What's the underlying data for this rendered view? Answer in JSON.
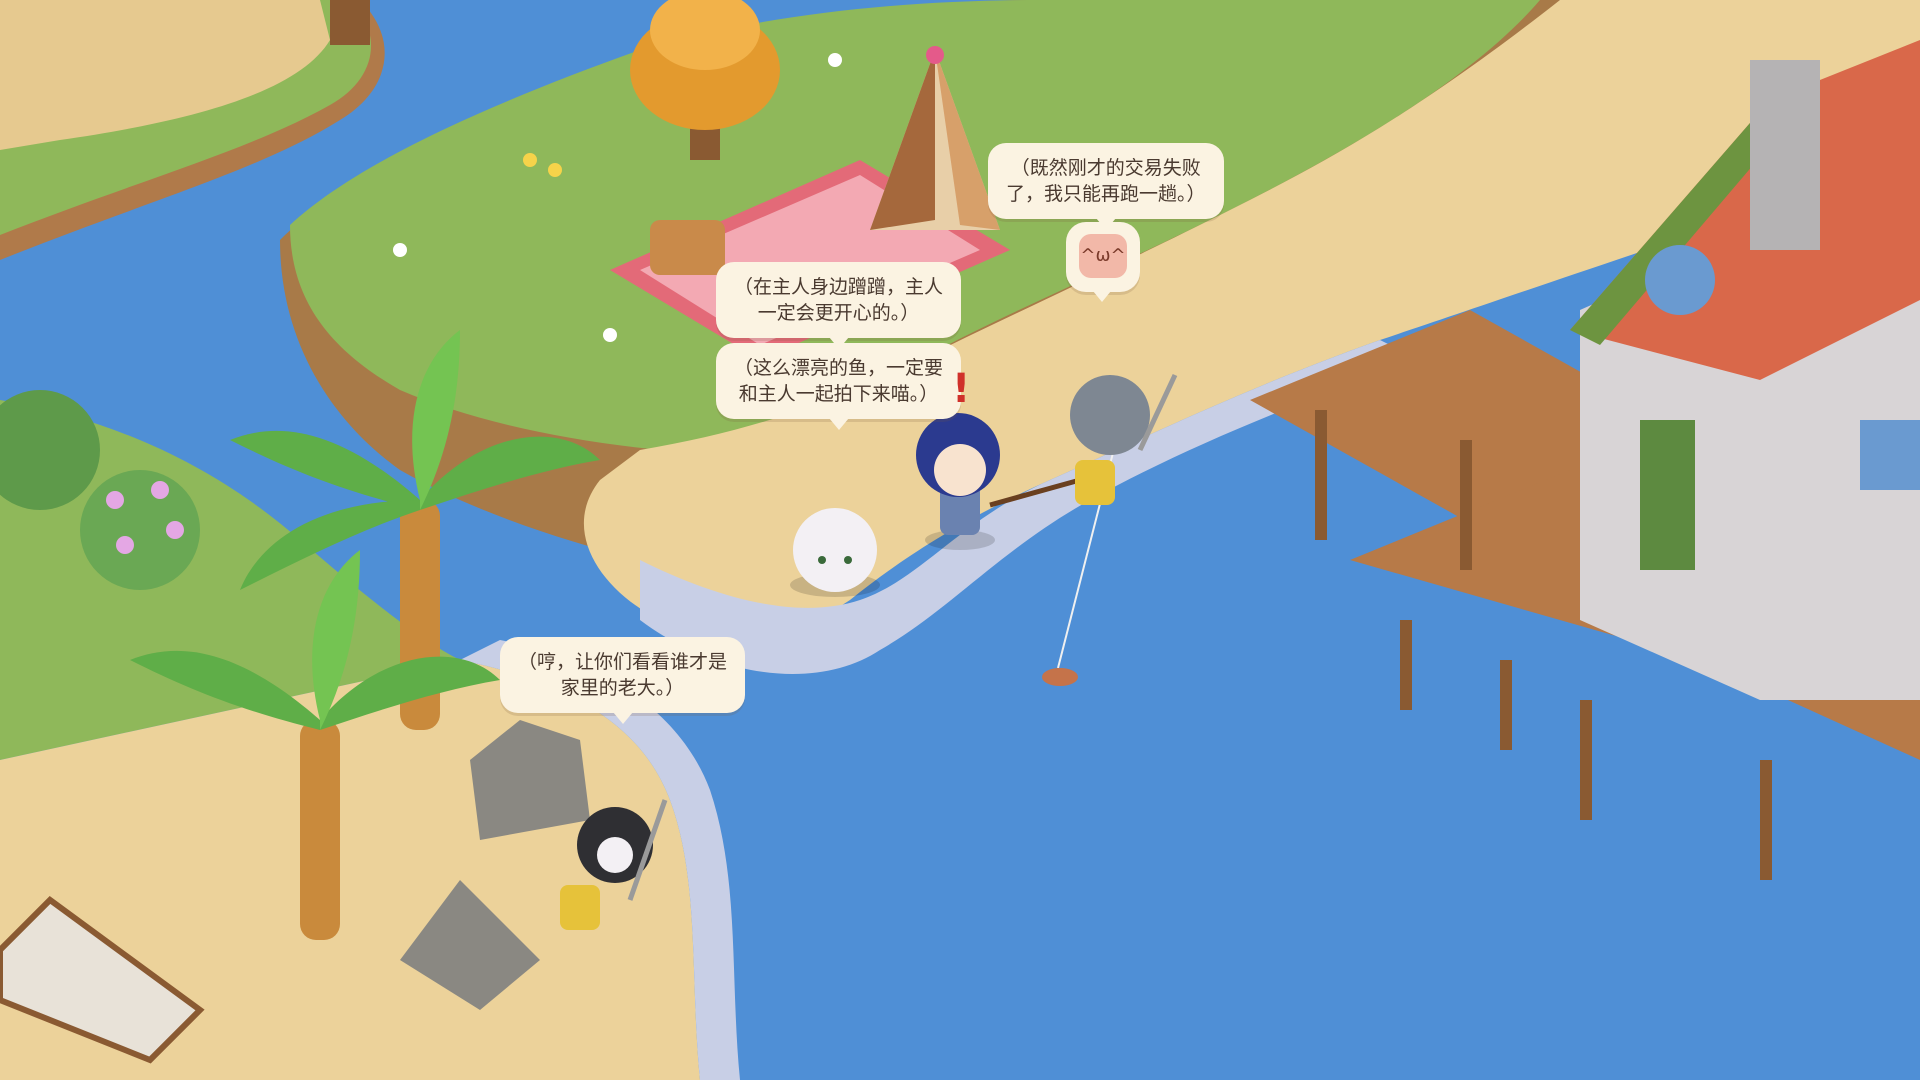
{
  "dialogues": {
    "cat_dog_thought": {
      "lines": [
        "（在主人身边蹭蹭，主人",
        "一定会更开心的。）"
      ]
    },
    "player_thought": {
      "lines": [
        "（这么漂亮的鱼，一定要",
        "和主人一起拍下来喵。）"
      ]
    },
    "gray_cat_thought": {
      "lines": [
        "（既然刚才的交易失败",
        "了，我只能再跑一趟。）"
      ]
    },
    "tuxedo_cat_thought": {
      "lines": [
        "（哼，让你们看看谁才是",
        "家里的老大。）"
      ]
    }
  },
  "emote": {
    "icon": "happy-cat-face-icon"
  },
  "alert": {
    "symbol": "!",
    "color": "#d0302a"
  },
  "colors": {
    "water": "#4f8fd6",
    "grass": "#8fb85a",
    "sand": "#ecd29a",
    "roof": "#d9684a",
    "dock": "#9a6238"
  }
}
